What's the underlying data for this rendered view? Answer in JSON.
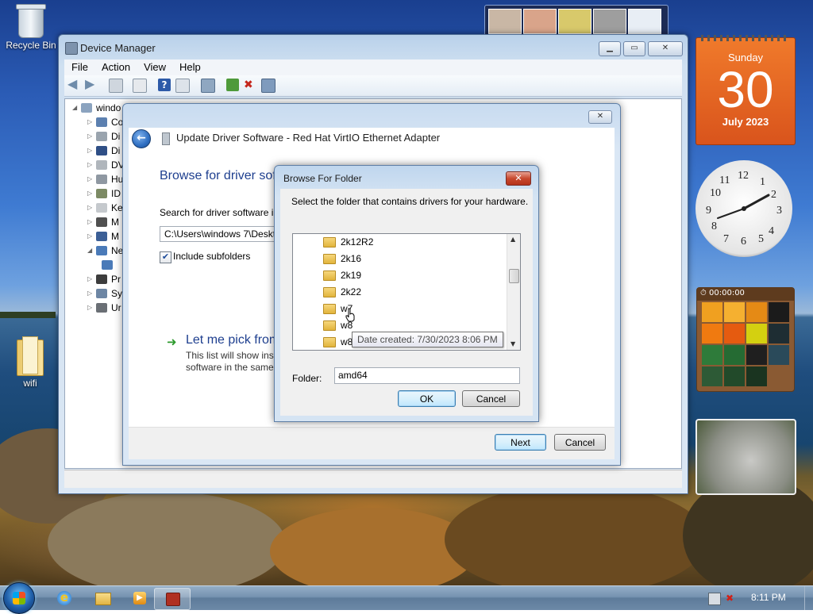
{
  "desktop": {
    "icons": [
      {
        "label": "Recycle Bin"
      },
      {
        "label": "wifi"
      }
    ]
  },
  "calendar": {
    "weekday": "Sunday",
    "day": "30",
    "month_year": "July 2023"
  },
  "clock": {
    "time": "8:11",
    "numerals": [
      "12",
      "1",
      "2",
      "3",
      "4",
      "5",
      "6",
      "7",
      "8",
      "9",
      "10",
      "11"
    ]
  },
  "puzzle": {
    "timer": "00:00:00"
  },
  "device_manager": {
    "title": "Device Manager",
    "menu": [
      "File",
      "Action",
      "View",
      "Help"
    ],
    "tree": {
      "root": "windo",
      "nodes": [
        "Co",
        "Di",
        "Di",
        "DV",
        "Hu",
        "ID",
        "Ke",
        "M",
        "M",
        "Ne",
        "Pr",
        "Sy",
        "Ur"
      ]
    }
  },
  "update_driver": {
    "header": "Update Driver Software - Red Hat VirtIO Ethernet Adapter",
    "heading": "Browse for driver sof",
    "search_label": "Search for driver software i",
    "path_value": "C:\\Users\\windows 7\\Deskt",
    "include_subfolders": "Include subfolders",
    "pick_title": "Let me pick from",
    "pick_desc_1": "This list will show inst",
    "pick_desc_2": "software in the same",
    "next_label": "Next",
    "cancel_label": "Cancel"
  },
  "browse_folder": {
    "title": "Browse For Folder",
    "close_label": "✕",
    "instruction": "Select the folder that contains drivers for your hardware.",
    "folders": [
      "2k12R2",
      "2k16",
      "2k19",
      "2k22",
      "w7",
      "w8",
      "w8"
    ],
    "tooltip": "Date created: 7/30/2023 8:06 PM",
    "folder_label": "Folder:",
    "folder_value": "amd64",
    "ok_label": "OK",
    "cancel_label": "Cancel"
  },
  "taskbar": {
    "time": "8:11 PM"
  }
}
